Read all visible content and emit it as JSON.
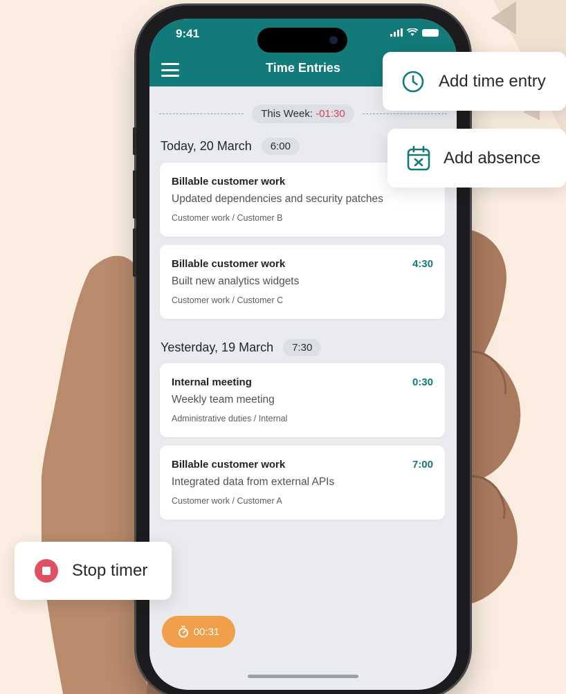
{
  "status_bar": {
    "time": "9:41"
  },
  "header": {
    "title": "Time Entries"
  },
  "week_summary": {
    "label": "This Week:",
    "value": "-01:30"
  },
  "days": [
    {
      "label": "Today, 20 March",
      "total": "6:00",
      "entries": [
        {
          "title": "Billable customer work",
          "description": "Updated dependencies and security patches",
          "path": "Customer work / Customer B",
          "duration": ""
        },
        {
          "title": "Billable customer work",
          "description": "Built new analytics widgets",
          "path": "Customer work / Customer C",
          "duration": "4:30"
        }
      ]
    },
    {
      "label": "Yesterday, 19 March",
      "total": "7:30",
      "entries": [
        {
          "title": "Internal meeting",
          "description": "Weekly team meeting",
          "path": "Administrative duties / Internal",
          "duration": "0:30"
        },
        {
          "title": "Billable customer work",
          "description": "Integrated data from external APIs",
          "path": "Customer work / Customer A",
          "duration": "7:00"
        }
      ]
    }
  ],
  "timer": {
    "elapsed": "00:31",
    "icon": "stopwatch-icon"
  },
  "popups": {
    "add_time_entry": {
      "label": "Add time entry",
      "icon": "clock-icon"
    },
    "add_absence": {
      "label": "Add absence",
      "icon": "calendar-x-icon"
    },
    "stop_timer": {
      "label": "Stop timer",
      "icon": "stop-icon"
    }
  },
  "colors": {
    "primary": "#127a79",
    "accent": "#f0a04a",
    "danger": "#d24454",
    "background": "#fbeee0"
  }
}
